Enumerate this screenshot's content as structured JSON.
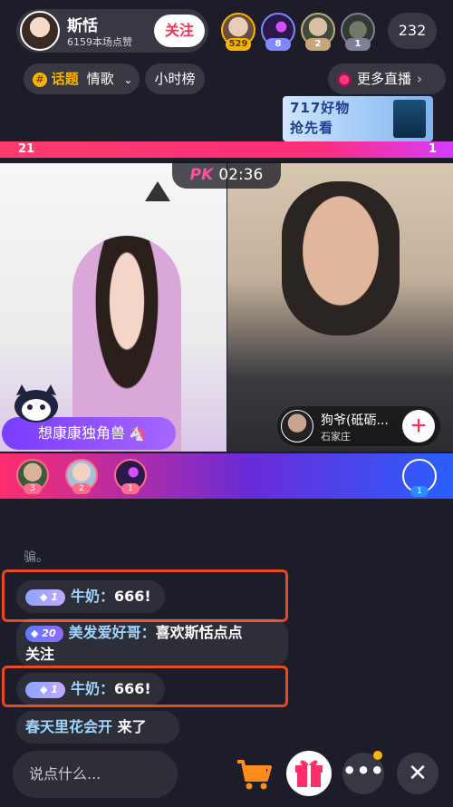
{
  "host": {
    "name": "斯恬",
    "likes": "6159本场点赞",
    "follow_label": "关注"
  },
  "viewers": [
    {
      "badge": "529",
      "badge_color": "#f7b500"
    },
    {
      "badge": "8",
      "badge_color": "#7d8aff"
    },
    {
      "badge": "2",
      "badge_color": "#c9a57a"
    },
    {
      "badge": "1",
      "badge_color": "#7f7f96"
    }
  ],
  "viewer_count": "232",
  "topic": {
    "icon_label": "#",
    "prefix": "话题",
    "name": "情歌"
  },
  "hour_rank_label": "小时榜",
  "more_live_label": "更多直播",
  "banner": {
    "line1": "717好物",
    "line2": "抢先看"
  },
  "pk": {
    "left_score": "21",
    "right_score": "1",
    "logo": "PK",
    "timer": "02:36"
  },
  "anchor": {
    "name": "想康康独角兽"
  },
  "opponent": {
    "name": "狗爷(砥砺...",
    "location": "石家庄",
    "follow_symbol": "+"
  },
  "contributors": [
    {
      "badge": "3",
      "badge_color": "#ff6b8a"
    },
    {
      "badge": "2",
      "badge_color": "#ff6b8a"
    },
    {
      "badge": "1",
      "badge_color": "#ff6b8a"
    }
  ],
  "right_contributor_badge": "1",
  "comments": {
    "partial": "骗。",
    "c1": {
      "badge": "1",
      "user": "牛奶：",
      "text": "666!"
    },
    "c2": {
      "badge": "20",
      "user": "美发爱好哥：",
      "text": "喜欢斯恬点点",
      "text2": "关注"
    },
    "c3": {
      "badge": "1",
      "user": "牛奶：",
      "text": "666!"
    },
    "c4": {
      "user": "春天里花会开",
      "text": " 来了"
    }
  },
  "input_placeholder": "说点什么...",
  "more_symbol": "•••",
  "close_symbol": "✕",
  "colors": {
    "accent": "#fe2c55",
    "highlight": "#e64a1e"
  }
}
